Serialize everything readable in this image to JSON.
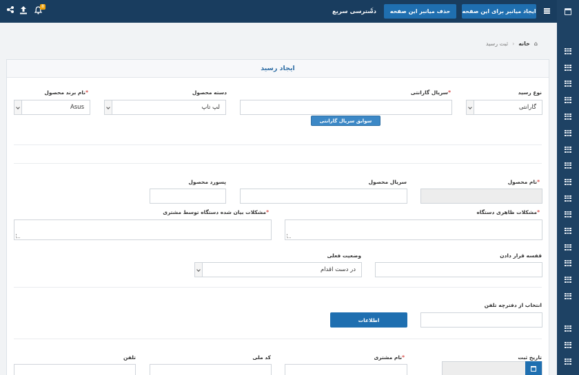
{
  "topbar": {
    "btn_create_shortcut": "ایجاد میانبر برای این صفحه",
    "btn_delete_shortcut": "حذف میانبر این صفحه",
    "quick_access": "دسترسی سریع",
    "notification_count": "8"
  },
  "breadcrumb": {
    "home": "خانه",
    "current": "ثبت رسید"
  },
  "panel": {
    "title": "ایجاد رسید"
  },
  "form": {
    "receipt_type_label": "نوع رسید",
    "receipt_type_value": "گارانتی",
    "warranty_serial_label": "سریال گارانتی",
    "warranty_history_button": "سوابق سریال گارانتی",
    "product_category_label": "دسته محصول",
    "product_category_value": "لپ تاپ",
    "product_brand_label": "نام برند محصول",
    "product_brand_value": "Asus",
    "product_name_label": "نام محصول",
    "product_serial_label": "سریال محصول",
    "product_password_label": "پسورد محصول",
    "visible_problems_label": "مشکلات ظاهری دستگاه",
    "customer_problems_label": "مشکلات بیان شده دستگاه توسط مشتری",
    "shelf_label": "قفسه قرار دادن",
    "current_status_label": "وضعیت فعلی",
    "current_status_value": "در دست اقدام",
    "phonebook_label": "انتخاب از دفترچه تلفن",
    "info_button": "اطلاعات",
    "registration_date_label": "تاریخ ثبت",
    "customer_name_label": "نام مشتری",
    "national_code_label": "کد ملی",
    "phone_label": "تلفن",
    "required_mark": "*"
  },
  "colors": {
    "topbar": "#193d5f",
    "primary_button": "#1f6fb0",
    "required": "#d9534f",
    "title": "#2e6da4"
  },
  "icons": {
    "sidebar": [
      "calendar-icon",
      "grid-icon"
    ],
    "topbar_left": [
      "share-icon",
      "upload-icon",
      "bell-icon"
    ],
    "home": "home-icon",
    "quick_access": "bolt-icon",
    "menu": "hamburger-icon"
  }
}
